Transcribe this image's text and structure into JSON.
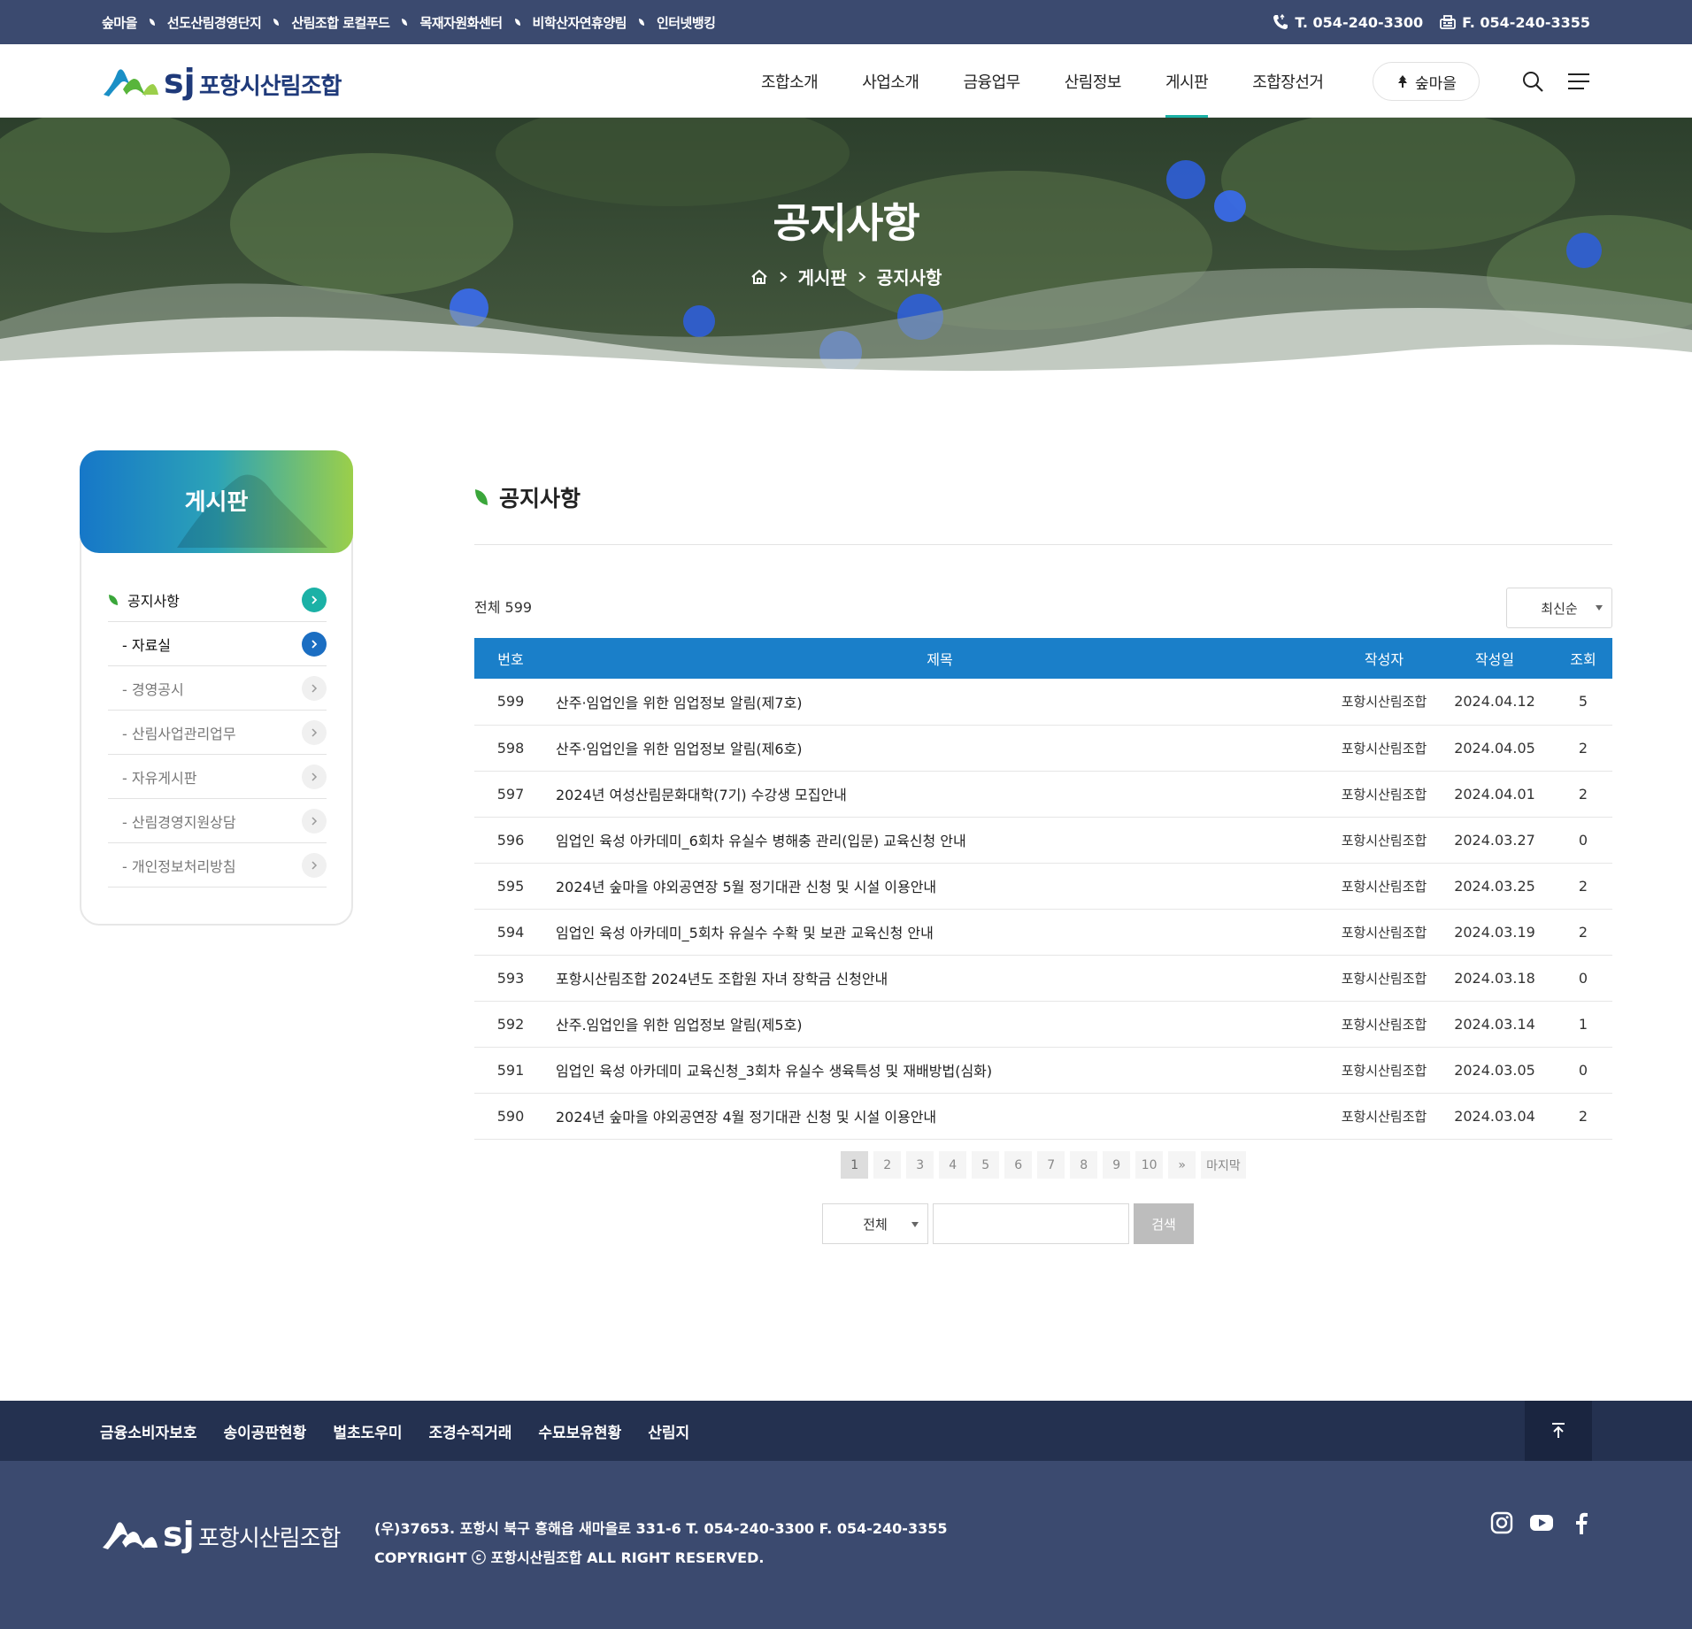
{
  "topbar": {
    "links": [
      "숲마을",
      "선도산림경영단지",
      "산림조합 로컬푸드",
      "목재자원화센터",
      "비학산자연휴양림",
      "인터넷뱅킹"
    ],
    "tel": "T. 054-240-3300",
    "fax": "F. 054-240-3355"
  },
  "header": {
    "logo_text": "포항시산림조합",
    "logo_mark": "sj",
    "nav": [
      "조합소개",
      "사업소개",
      "금융업무",
      "산림정보",
      "게시판",
      "조합장선거"
    ],
    "active_nav": "게시판",
    "forest_button": "숲마을"
  },
  "hero": {
    "title": "공지사항",
    "breadcrumb": [
      "게시판",
      "공지사항"
    ]
  },
  "sidebar": {
    "title": "게시판",
    "items": [
      {
        "label": "공지사항"
      },
      {
        "label": "- 자료실"
      },
      {
        "label": "- 경영공시"
      },
      {
        "label": "- 산림사업관리업무"
      },
      {
        "label": "- 자유게시판"
      },
      {
        "label": "- 산림경영지원상담"
      },
      {
        "label": "- 개인정보처리방침"
      }
    ]
  },
  "content": {
    "title": "공지사항",
    "total": "전체 599",
    "sort": "최신순",
    "columns": [
      "번호",
      "제목",
      "작성자",
      "작성일",
      "조회"
    ],
    "rows": [
      {
        "no": "599",
        "title": "산주·임업인을 위한 임업정보 알림(제7호)",
        "writer": "포항시산림조합",
        "date": "2024.04.12",
        "views": "5"
      },
      {
        "no": "598",
        "title": "산주·임업인을 위한 임업정보 알림(제6호)",
        "writer": "포항시산림조합",
        "date": "2024.04.05",
        "views": "2"
      },
      {
        "no": "597",
        "title": "2024년 여성산림문화대학(7기) 수강생 모집안내",
        "writer": "포항시산림조합",
        "date": "2024.04.01",
        "views": "2"
      },
      {
        "no": "596",
        "title": "임업인 육성 아카데미_6회차 유실수 병해충 관리(입문) 교육신청 안내",
        "writer": "포항시산림조합",
        "date": "2024.03.27",
        "views": "0"
      },
      {
        "no": "595",
        "title": "2024년 숲마을 야외공연장 5월 정기대관 신청 및 시설 이용안내",
        "writer": "포항시산림조합",
        "date": "2024.03.25",
        "views": "2"
      },
      {
        "no": "594",
        "title": "임업인 육성 아카데미_5회차 유실수 수확 및 보관 교육신청 안내",
        "writer": "포항시산림조합",
        "date": "2024.03.19",
        "views": "2"
      },
      {
        "no": "593",
        "title": "포항시산림조합 2024년도 조합원 자녀 장학금 신청안내",
        "writer": "포항시산림조합",
        "date": "2024.03.18",
        "views": "0"
      },
      {
        "no": "592",
        "title": "산주.임업인을 위한 임업정보 알림(제5호)",
        "writer": "포항시산림조합",
        "date": "2024.03.14",
        "views": "1"
      },
      {
        "no": "591",
        "title": "임업인 육성 아카데미 교육신청_3회차 유실수 생육특성 및 재배방법(심화)",
        "writer": "포항시산림조합",
        "date": "2024.03.05",
        "views": "0"
      },
      {
        "no": "590",
        "title": "2024년 숲마을 야외공연장 4월 정기대관 신청 및 시설 이용안내",
        "writer": "포항시산림조합",
        "date": "2024.03.04",
        "views": "2"
      }
    ],
    "pager": [
      "1",
      "2",
      "3",
      "4",
      "5",
      "6",
      "7",
      "8",
      "9",
      "10",
      "»",
      "마지막"
    ],
    "current_page": "1",
    "search_scope": "전체",
    "search_value": "",
    "search_button": "검색"
  },
  "footer": {
    "links": [
      "금융소비자보호",
      "송이공판현황",
      "벌초도우미",
      "조경수직거래",
      "수묘보유현황",
      "산림지"
    ],
    "logo_text": "포항시산림조합",
    "logo_mark": "sj",
    "address": "(우)37653. 포항시 북구 흥해읍 새마을로 331-6 T. 054-240-3300 F. 054-240-3355",
    "copyright": "COPYRIGHT ⓒ 포항시산림조합 ALL RIGHT RESERVED."
  },
  "colors": {
    "topbar": "#3b4a6f",
    "footer_links": "#243150",
    "table_header": "#1a7fc9",
    "accent_teal": "#1bb1a6",
    "accent_blue": "#1b6ec2",
    "accent_green": "#9bcf4a"
  },
  "icons": {
    "topbar_sep": "leaf-icon",
    "tel": "phone-icon",
    "fax": "fax-icon",
    "search": "search-icon",
    "menu": "hamburger-icon",
    "home": "home-icon",
    "to_top": "arrow-up-icon",
    "sns": [
      "instagram-icon",
      "youtube-icon",
      "facebook-icon"
    ]
  }
}
